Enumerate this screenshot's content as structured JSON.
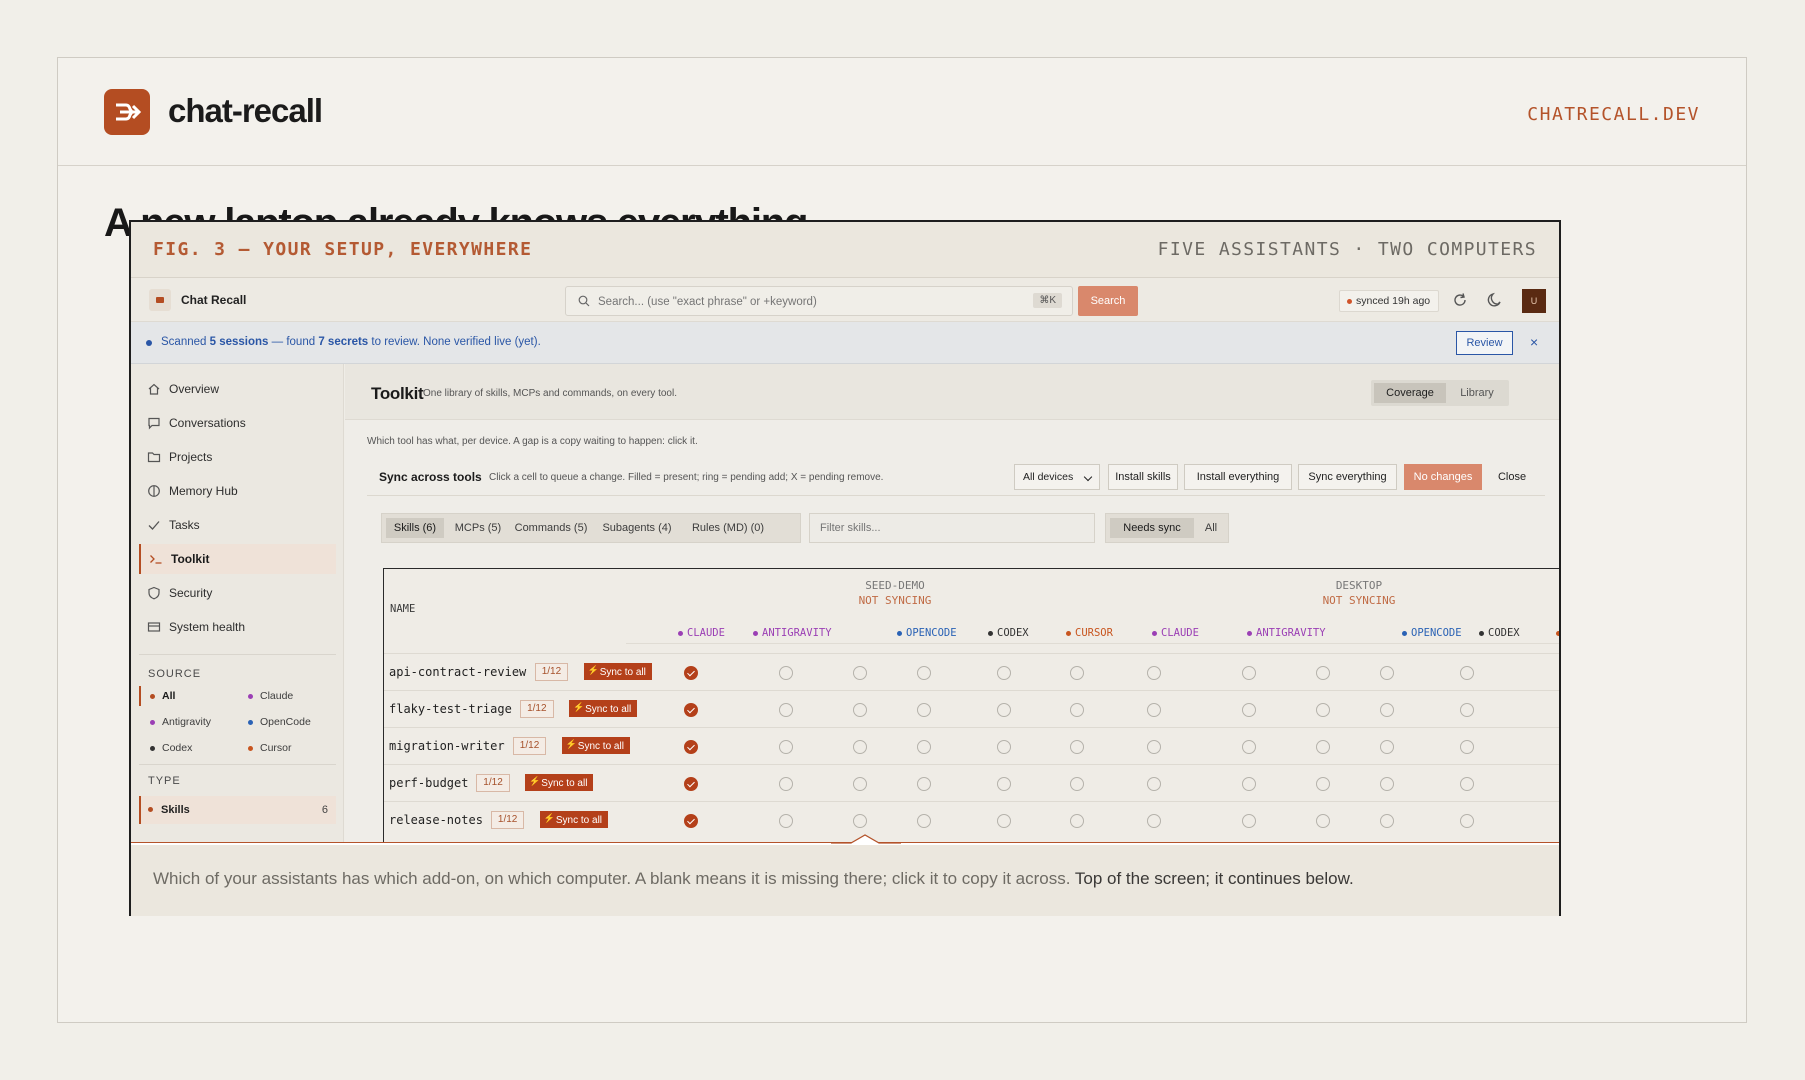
{
  "site": {
    "brand": "chat-recall",
    "domain": "CHATRECALL.DEV",
    "headline": "A new laptop already knows everything",
    "brand_color": "#b44d22"
  },
  "figure": {
    "title": "FIG. 3 — YOUR SETUP, EVERYWHERE",
    "meta": "FIVE ASSISTANTS  ·  TWO COMPUTERS",
    "caption": "Which of your assistants has which add-on, on which computer. A blank means it is missing there; click it to copy it across.",
    "caption_strong": "Top of the screen; it continues below."
  },
  "app": {
    "name": "Chat Recall",
    "search_placeholder": "Search... (use \"exact phrase\" or +keyword)",
    "search_kbd": "⌘K",
    "search_button": "Search",
    "synced": "synced 19h ago",
    "avatar": "U",
    "icons": [
      "refresh-icon",
      "moon-icon"
    ]
  },
  "notice": {
    "prefix": "Scanned",
    "sessions": "5 sessions",
    "middle": "— found",
    "secrets": "7 secrets",
    "suffix": "to review. None verified live (yet).",
    "review": "Review",
    "close": "×"
  },
  "sidebar": {
    "items": [
      {
        "label": "Overview",
        "icon": "home-icon"
      },
      {
        "label": "Conversations",
        "icon": "chat-icon"
      },
      {
        "label": "Projects",
        "icon": "folder-icon"
      },
      {
        "label": "Memory Hub",
        "icon": "brain-icon"
      },
      {
        "label": "Tasks",
        "icon": "check-icon"
      },
      {
        "label": "Toolkit",
        "icon": "terminal-icon"
      },
      {
        "label": "Security",
        "icon": "shield-icon"
      },
      {
        "label": "System health",
        "icon": "monitor-icon"
      }
    ],
    "source_heading": "SOURCE",
    "sources": [
      {
        "label": "All",
        "color": "#b44d22"
      },
      {
        "label": "Claude",
        "color": "#9b3fb5"
      },
      {
        "label": "Antigravity",
        "color": "#9b3fb5"
      },
      {
        "label": "OpenCode",
        "color": "#2a62b5"
      },
      {
        "label": "Codex",
        "color": "#333333"
      },
      {
        "label": "Cursor",
        "color": "#c8551f"
      }
    ],
    "type_heading": "TYPE",
    "type_item": {
      "label": "Skills",
      "count": "6"
    }
  },
  "toolkit": {
    "title": "Toolkit",
    "subtitle": "One library of skills, MCPs and commands, on every tool.",
    "view_coverage": "Coverage",
    "view_library": "Library",
    "hint": "Which tool has what, per device. A gap is a copy waiting to happen: click it.",
    "sync_title": "Sync across tools",
    "sync_desc": "Click a cell to queue a change. Filled = present; ring = pending add; X = pending remove.",
    "device_select": "All devices",
    "btn_install_skills": "Install skills",
    "btn_install_everything": "Install everything",
    "btn_sync_everything": "Sync everything",
    "btn_no_changes": "No changes",
    "btn_close": "Close",
    "tabs": [
      "Skills (6)",
      "MCPs (5)",
      "Commands (5)",
      "Subagents (4)",
      "Rules (MD) (0)"
    ],
    "filter_placeholder": "Filter skills...",
    "needs_sync": "Needs sync",
    "all": "All"
  },
  "table": {
    "name_header": "NAME",
    "devices": [
      {
        "name": "SEED-DEMO",
        "status": "NOT SYNCING"
      },
      {
        "name": "DESKTOP",
        "status": "NOT SYNCING"
      }
    ],
    "tools": [
      {
        "label": "CLAUDE",
        "color": "#9b3fb5"
      },
      {
        "label": "ANTIGRAVITY",
        "color": "#9b3fb5"
      },
      {
        "label": "OPENCODE",
        "color": "#2a62b5"
      },
      {
        "label": "CODEX",
        "color": "#333333"
      },
      {
        "label": "CURSOR",
        "color": "#c8551f"
      },
      {
        "label": "CLAUDE",
        "color": "#9b3fb5"
      },
      {
        "label": "ANTIGRAVITY",
        "color": "#9b3fb5"
      },
      {
        "label": "OPENCODE",
        "color": "#2a62b5"
      },
      {
        "label": "CODEX",
        "color": "#333333"
      },
      {
        "label": "C",
        "color": "#c8551f"
      }
    ],
    "sync_label": "Sync to all",
    "rows": [
      {
        "name": "api-contract-review",
        "count": "1/12",
        "cells": [
          1,
          0,
          0,
          0,
          0,
          0,
          0,
          0,
          0,
          0,
          0
        ]
      },
      {
        "name": "flaky-test-triage",
        "count": "1/12",
        "cells": [
          1,
          0,
          0,
          0,
          0,
          0,
          0,
          0,
          0,
          0,
          0
        ]
      },
      {
        "name": "migration-writer",
        "count": "1/12",
        "cells": [
          1,
          0,
          0,
          0,
          0,
          0,
          0,
          0,
          0,
          0,
          0
        ]
      },
      {
        "name": "perf-budget",
        "count": "1/12",
        "cells": [
          1,
          0,
          0,
          0,
          0,
          0,
          0,
          0,
          0,
          0,
          0
        ]
      },
      {
        "name": "release-notes",
        "count": "1/12",
        "cells": [
          1,
          0,
          0,
          0,
          0,
          0,
          0,
          0,
          0,
          0,
          0
        ]
      }
    ]
  }
}
